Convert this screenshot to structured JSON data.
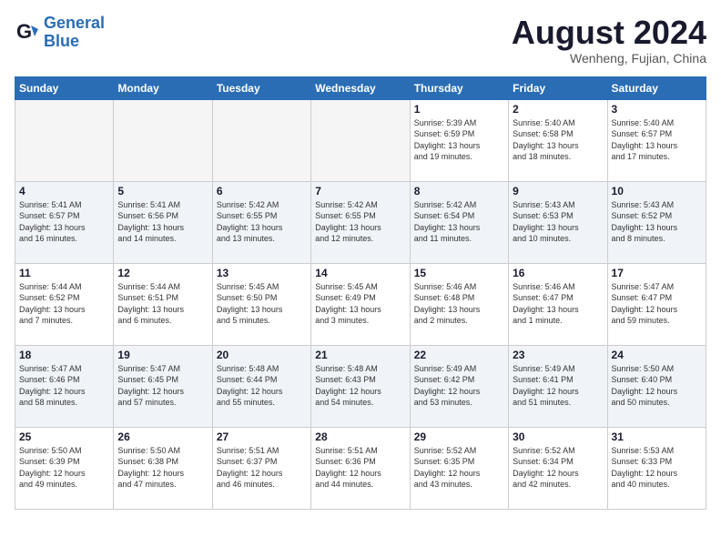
{
  "logo": {
    "line1": "General",
    "line2": "Blue"
  },
  "title": "August 2024",
  "subtitle": "Wenheng, Fujian, China",
  "weekdays": [
    "Sunday",
    "Monday",
    "Tuesday",
    "Wednesday",
    "Thursday",
    "Friday",
    "Saturday"
  ],
  "weeks": [
    [
      {
        "day": "",
        "info": ""
      },
      {
        "day": "",
        "info": ""
      },
      {
        "day": "",
        "info": ""
      },
      {
        "day": "",
        "info": ""
      },
      {
        "day": "1",
        "info": "Sunrise: 5:39 AM\nSunset: 6:59 PM\nDaylight: 13 hours\nand 19 minutes."
      },
      {
        "day": "2",
        "info": "Sunrise: 5:40 AM\nSunset: 6:58 PM\nDaylight: 13 hours\nand 18 minutes."
      },
      {
        "day": "3",
        "info": "Sunrise: 5:40 AM\nSunset: 6:57 PM\nDaylight: 13 hours\nand 17 minutes."
      }
    ],
    [
      {
        "day": "4",
        "info": "Sunrise: 5:41 AM\nSunset: 6:57 PM\nDaylight: 13 hours\nand 16 minutes."
      },
      {
        "day": "5",
        "info": "Sunrise: 5:41 AM\nSunset: 6:56 PM\nDaylight: 13 hours\nand 14 minutes."
      },
      {
        "day": "6",
        "info": "Sunrise: 5:42 AM\nSunset: 6:55 PM\nDaylight: 13 hours\nand 13 minutes."
      },
      {
        "day": "7",
        "info": "Sunrise: 5:42 AM\nSunset: 6:55 PM\nDaylight: 13 hours\nand 12 minutes."
      },
      {
        "day": "8",
        "info": "Sunrise: 5:42 AM\nSunset: 6:54 PM\nDaylight: 13 hours\nand 11 minutes."
      },
      {
        "day": "9",
        "info": "Sunrise: 5:43 AM\nSunset: 6:53 PM\nDaylight: 13 hours\nand 10 minutes."
      },
      {
        "day": "10",
        "info": "Sunrise: 5:43 AM\nSunset: 6:52 PM\nDaylight: 13 hours\nand 8 minutes."
      }
    ],
    [
      {
        "day": "11",
        "info": "Sunrise: 5:44 AM\nSunset: 6:52 PM\nDaylight: 13 hours\nand 7 minutes."
      },
      {
        "day": "12",
        "info": "Sunrise: 5:44 AM\nSunset: 6:51 PM\nDaylight: 13 hours\nand 6 minutes."
      },
      {
        "day": "13",
        "info": "Sunrise: 5:45 AM\nSunset: 6:50 PM\nDaylight: 13 hours\nand 5 minutes."
      },
      {
        "day": "14",
        "info": "Sunrise: 5:45 AM\nSunset: 6:49 PM\nDaylight: 13 hours\nand 3 minutes."
      },
      {
        "day": "15",
        "info": "Sunrise: 5:46 AM\nSunset: 6:48 PM\nDaylight: 13 hours\nand 2 minutes."
      },
      {
        "day": "16",
        "info": "Sunrise: 5:46 AM\nSunset: 6:47 PM\nDaylight: 13 hours\nand 1 minute."
      },
      {
        "day": "17",
        "info": "Sunrise: 5:47 AM\nSunset: 6:47 PM\nDaylight: 12 hours\nand 59 minutes."
      }
    ],
    [
      {
        "day": "18",
        "info": "Sunrise: 5:47 AM\nSunset: 6:46 PM\nDaylight: 12 hours\nand 58 minutes."
      },
      {
        "day": "19",
        "info": "Sunrise: 5:47 AM\nSunset: 6:45 PM\nDaylight: 12 hours\nand 57 minutes."
      },
      {
        "day": "20",
        "info": "Sunrise: 5:48 AM\nSunset: 6:44 PM\nDaylight: 12 hours\nand 55 minutes."
      },
      {
        "day": "21",
        "info": "Sunrise: 5:48 AM\nSunset: 6:43 PM\nDaylight: 12 hours\nand 54 minutes."
      },
      {
        "day": "22",
        "info": "Sunrise: 5:49 AM\nSunset: 6:42 PM\nDaylight: 12 hours\nand 53 minutes."
      },
      {
        "day": "23",
        "info": "Sunrise: 5:49 AM\nSunset: 6:41 PM\nDaylight: 12 hours\nand 51 minutes."
      },
      {
        "day": "24",
        "info": "Sunrise: 5:50 AM\nSunset: 6:40 PM\nDaylight: 12 hours\nand 50 minutes."
      }
    ],
    [
      {
        "day": "25",
        "info": "Sunrise: 5:50 AM\nSunset: 6:39 PM\nDaylight: 12 hours\nand 49 minutes."
      },
      {
        "day": "26",
        "info": "Sunrise: 5:50 AM\nSunset: 6:38 PM\nDaylight: 12 hours\nand 47 minutes."
      },
      {
        "day": "27",
        "info": "Sunrise: 5:51 AM\nSunset: 6:37 PM\nDaylight: 12 hours\nand 46 minutes."
      },
      {
        "day": "28",
        "info": "Sunrise: 5:51 AM\nSunset: 6:36 PM\nDaylight: 12 hours\nand 44 minutes."
      },
      {
        "day": "29",
        "info": "Sunrise: 5:52 AM\nSunset: 6:35 PM\nDaylight: 12 hours\nand 43 minutes."
      },
      {
        "day": "30",
        "info": "Sunrise: 5:52 AM\nSunset: 6:34 PM\nDaylight: 12 hours\nand 42 minutes."
      },
      {
        "day": "31",
        "info": "Sunrise: 5:53 AM\nSunset: 6:33 PM\nDaylight: 12 hours\nand 40 minutes."
      }
    ]
  ]
}
